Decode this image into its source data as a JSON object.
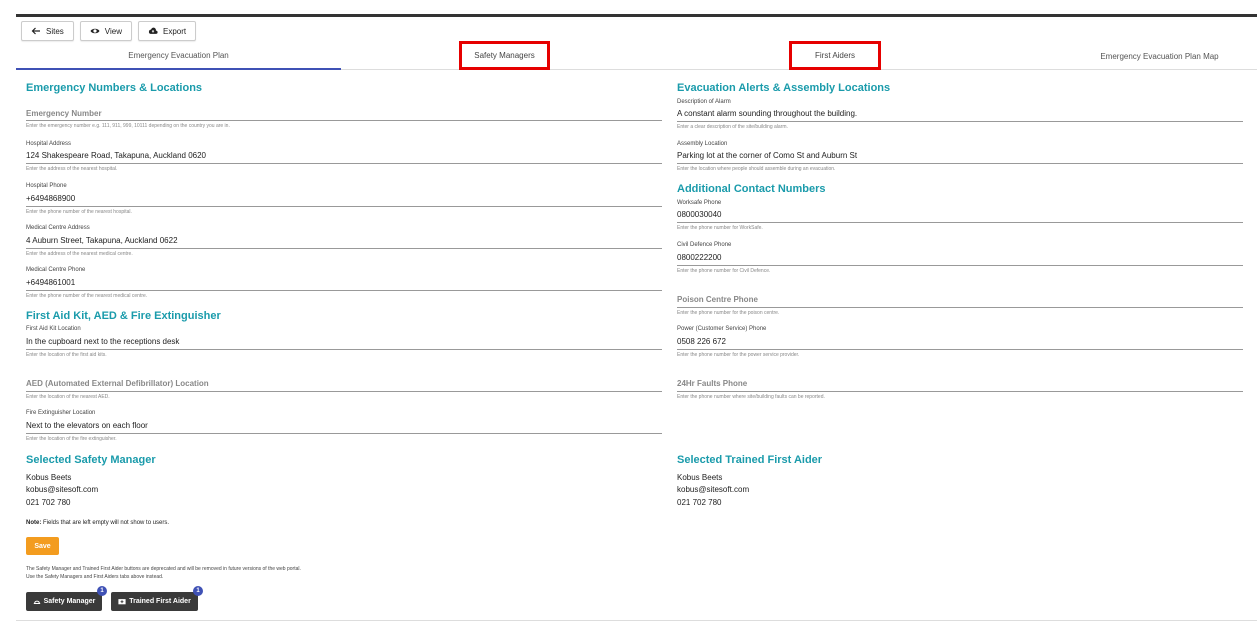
{
  "toolbar": {
    "sites_label": "Sites",
    "view_label": "View",
    "export_label": "Export"
  },
  "tabs": [
    {
      "label": "Emergency Evacuation Plan"
    },
    {
      "label": "Safety Managers"
    },
    {
      "label": "First Aiders"
    },
    {
      "label": "Emergency Evacuation Plan Map"
    }
  ],
  "left": {
    "section1_title": "Emergency Numbers & Locations",
    "emergency_number": {
      "label": "Emergency Number",
      "help": "Enter the emergency number e.g. 111, 911, 999, 10111 depending on the country you are in."
    },
    "hospital_address": {
      "label": "Hospital Address",
      "value": "124 Shakespeare Road, Takapuna, Auckland 0620",
      "help": "Enter the address of the nearest hospital."
    },
    "hospital_phone": {
      "label": "Hospital Phone",
      "value": "+6494868900",
      "help": "Enter the phone number of the nearest hospital."
    },
    "medical_address": {
      "label": "Medical Centre Address",
      "value": "4 Auburn Street, Takapuna, Auckland 0622",
      "help": "Enter the address of the nearest medical centre."
    },
    "medical_phone": {
      "label": "Medical Centre Phone",
      "value": "+6494861001",
      "help": "Enter the phone number of the nearest medical centre."
    },
    "section2_title": "First Aid Kit, AED & Fire Extinguisher",
    "first_aid_location": {
      "label": "First Aid Kit Location",
      "value": "In the cupboard next to the receptions desk",
      "help": "Enter the location of the first aid kits."
    },
    "aed_location": {
      "label": "AED (Automated External Defibrillator) Location",
      "help": "Enter the location of the nearest AED."
    },
    "fire_ext_location": {
      "label": "Fire Extinguisher Location",
      "value": "Next to the elevators on each floor",
      "help": "Enter the location of the fire extinguisher."
    },
    "section3_title": "Selected Safety Manager",
    "manager_name": "Kobus Beets",
    "manager_email": "kobus@sitesoft.com",
    "manager_phone": "021 702 780",
    "note_bold": "Note:",
    "note_text": " Fields that are left empty will not show to users.",
    "save_label": "Save",
    "deprecated_1": "The Safety Manager and Trained First Aider buttons are deprecated and will be removed in future versions of the web portal.",
    "deprecated_2": "Use the Safety Managers and First Aiders tabs above instead.",
    "safety_manager_btn": "Safety Manager",
    "safety_manager_count": "1",
    "trained_first_aider_btn": "Trained First Aider",
    "trained_first_aider_count": "1"
  },
  "right": {
    "section1_title": "Evacuation Alerts & Assembly Locations",
    "alarm": {
      "label": "Description of Alarm",
      "value": "A constant alarm sounding throughout the building.",
      "help": "Enter a clear description of the site/building alarm."
    },
    "assembly": {
      "label": "Assembly Location",
      "value": "Parking lot at the corner of Como St and Auburn St",
      "help": "Enter the location where people should assemble during an evacuation."
    },
    "section2_title": "Additional Contact Numbers",
    "worksafe": {
      "label": "Worksafe Phone",
      "value": "0800030040",
      "help": "Enter the phone number for WorkSafe."
    },
    "civil_defence": {
      "label": "Civil Defence Phone",
      "value": "0800222200",
      "help": "Enter the phone number for Civil Defence."
    },
    "poison": {
      "label": "Poison Centre Phone",
      "help": "Enter the phone number for the poison centre."
    },
    "power": {
      "label": "Power (Customer Service) Phone",
      "value": "0508 226 672",
      "help": "Enter the phone number for the power service provider."
    },
    "faults": {
      "label": "24Hr Faults Phone",
      "help": "Enter the phone number where site/building faults can be reported."
    },
    "section3_title": "Selected Trained First Aider",
    "aider_name": "Kobus Beets",
    "aider_email": "kobus@sitesoft.com",
    "aider_phone": "021 702 780"
  }
}
